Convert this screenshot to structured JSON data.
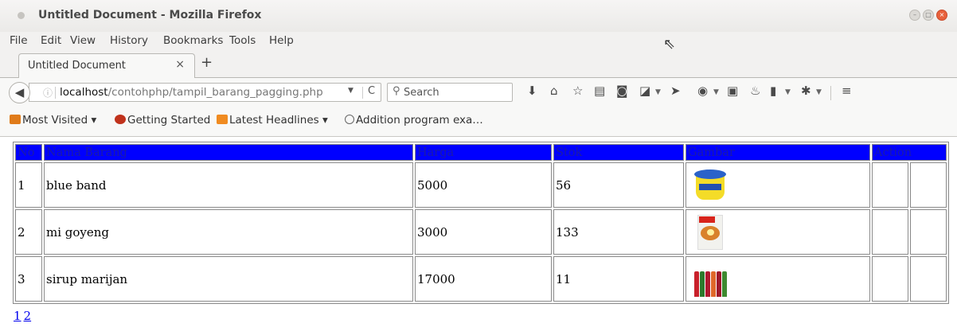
{
  "window": {
    "title": "Untitled Document - Mozilla Firefox"
  },
  "menu": [
    "File",
    "Edit",
    "View",
    "History",
    "Bookmarks",
    "Tools",
    "Help"
  ],
  "tab": {
    "title": "Untitled Document",
    "close": "×",
    "new_tab": "+"
  },
  "navbar": {
    "url_host": "localhost",
    "url_path": "/contohphp/tampil_barang_pagging.php",
    "search_placeholder": "Search"
  },
  "bookmarks": [
    {
      "label": "Most Visited ▾",
      "icon": "folder-icon"
    },
    {
      "label": "Getting Started",
      "icon": "firefox-icon"
    },
    {
      "label": "Latest Headlines ▾",
      "icon": "rss-icon"
    },
    {
      "label": "Addition program exa…",
      "icon": "globe-icon"
    }
  ],
  "table": {
    "headers": [
      "No",
      "Nama Barang",
      "Harga",
      "Stok",
      "Gambar",
      "Action"
    ],
    "header_bg": "#0000ff",
    "rows": [
      {
        "no": "1",
        "nama": "blue band",
        "harga": "5000",
        "stok": "56",
        "gambar_icon": "margarine-tub-image"
      },
      {
        "no": "2",
        "nama": "mi goyeng",
        "harga": "3000",
        "stok": "133",
        "gambar_icon": "instant-noodle-pack-image"
      },
      {
        "no": "3",
        "nama": "sirup marijan",
        "harga": "17000",
        "stok": "11",
        "gambar_icon": "syrup-bottles-image"
      }
    ]
  },
  "pagination": [
    "1",
    "2"
  ]
}
